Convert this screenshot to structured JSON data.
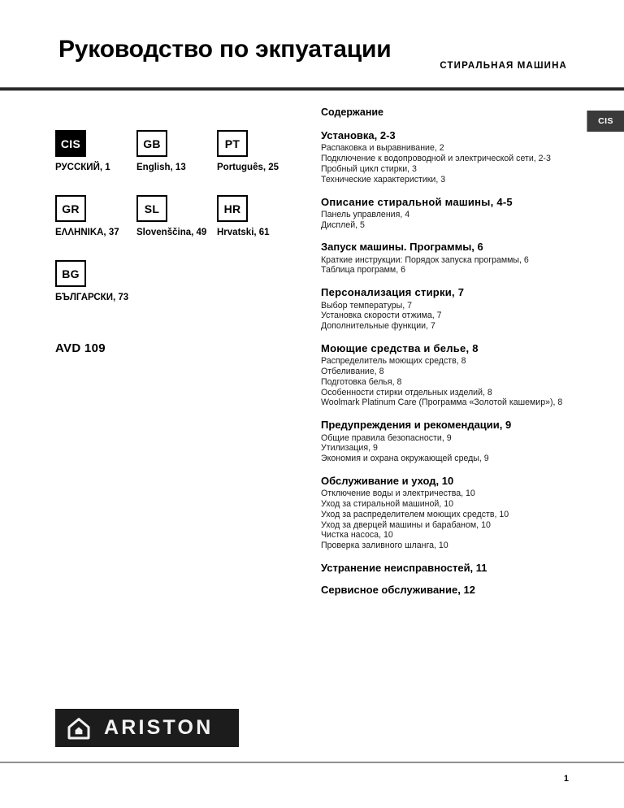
{
  "header": {
    "title": "Руководство по экпуатации",
    "appliance_kind": "СТИРАЛЬНАЯ МАШИНА",
    "corner_tab": "CIS"
  },
  "languages": [
    {
      "code": "CIS",
      "label": "РУССКИЙ, 1",
      "selected": true
    },
    {
      "code": "GB",
      "label": "English, 13",
      "selected": false
    },
    {
      "code": "PT",
      "label": "Português, 25",
      "selected": false
    },
    {
      "code": "GR",
      "label": "ΕΛΛΗΝΙΚΑ, 37",
      "selected": false
    },
    {
      "code": "SL",
      "label": "Slovenščina, 49",
      "selected": false
    },
    {
      "code": "HR",
      "label": "Hrvatski, 61",
      "selected": false
    },
    {
      "code": "BG",
      "label": "БЪЛГАРСКИ, 73",
      "selected": false
    }
  ],
  "model": "AVD 109",
  "toc": {
    "title": "Содержание",
    "sections": [
      {
        "heading": "Установка, 2-3",
        "entries": [
          "Распаковка и выравнивание, 2",
          "Подключение к водопроводной и электрической сети, 2-3",
          "Пробный цикл стирки, 3",
          "Технические характеристики, 3"
        ]
      },
      {
        "heading": "Описание  стиральной машины, 4-5",
        "entries": [
          "Панель управления, 4",
          "Дисплей, 5"
        ]
      },
      {
        "heading": "Запуск машины. Программы, 6",
        "entries": [
          "Краткие инструкции: Порядок запуска программы, 6",
          "Таблица программ, 6"
        ]
      },
      {
        "heading": "Персонализация стирки, 7",
        "entries": [
          "Выбор температуры, 7",
          "Установка скорости отжима, 7",
          "Дополнительные функции, 7"
        ]
      },
      {
        "heading": "Моющие средства и белье, 8",
        "entries": [
          "Распределитель моющих средств, 8",
          "Отбеливание, 8",
          "Подготовка белья, 8",
          "Особенности стирки отдельных изделий, 8",
          "Woolmark Platinum Care (Программа «Золотой кашемир»), 8"
        ]
      },
      {
        "heading": "Предупреждения и рекомендации, 9",
        "entries": [
          "Общие правила безопасности, 9",
          "Утилизация, 9",
          "Экономия и охрана окружающей среды, 9"
        ]
      },
      {
        "heading": "Обслуживание и уход, 10",
        "entries": [
          "Отключение воды и электричества, 10",
          "Уход за  стиральной машиной, 10",
          "Уход за распределителем моющих средств, 10",
          "Уход за дверцей машины и барабаном, 10",
          "Чистка насоса, 10",
          "Проверка заливного шланга, 10"
        ]
      },
      {
        "heading": "Устранение  неисправностей,  11",
        "entries": []
      },
      {
        "heading": "Сервисное обслуживание, 12",
        "entries": []
      }
    ]
  },
  "brand": {
    "name": "ARISTON",
    "mark": "house-icon"
  },
  "footer": {
    "page_number": "1"
  },
  "colors": {
    "rule": "#2b2b2b",
    "tab_background": "#3a3a3a",
    "logo_background": "#1c1c1c",
    "text": "#000000"
  }
}
